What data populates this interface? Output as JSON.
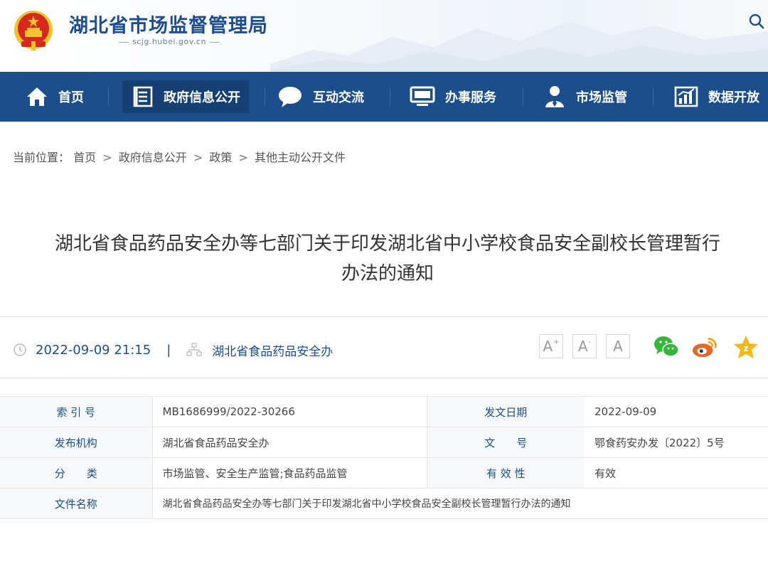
{
  "header": {
    "site_title": "湖北省市场监督管理局",
    "site_domain": "scjg.hubei.gov.cn"
  },
  "nav": {
    "items": [
      {
        "label": "首页",
        "icon": "home-icon"
      },
      {
        "label": "政府信息公开",
        "icon": "document-list-icon",
        "active": true
      },
      {
        "label": "互动交流",
        "icon": "chat-bubble-icon"
      },
      {
        "label": "办事服务",
        "icon": "monitor-icon"
      },
      {
        "label": "市场监管",
        "icon": "inspector-icon"
      },
      {
        "label": "数据开放",
        "icon": "bar-chart-icon"
      }
    ]
  },
  "breadcrumb": {
    "prefix": "当前位置：",
    "items": [
      "首页",
      "政府信息公开",
      "政策",
      "其他主动公开文件"
    ],
    "separator": ">"
  },
  "article": {
    "title_line1": "湖北省食品药品安全办等七部门关于印发湖北省中小学校食品安全副校长管理暂行",
    "title_line2": "办法的通知",
    "date": "2022-09-09 21:15",
    "divider": "|",
    "source": "湖北省食品药品安全办"
  },
  "font_controls": {
    "increase": "A",
    "increase_sup": "+",
    "decrease": "A",
    "decrease_sup": "-",
    "reset": "A"
  },
  "share": [
    "wechat-icon",
    "weibo-icon",
    "favorite-star-icon"
  ],
  "info_table": {
    "rows": [
      {
        "label1": "索 引 号",
        "value1": "MB1686999/2022-30266",
        "label2": "发文日期",
        "value2": "2022-09-09"
      },
      {
        "label1": "发布机构",
        "value1": "湖北省食品药品安全办",
        "label2": "文　　号",
        "value2": "鄂食药安办发〔2022〕5号"
      },
      {
        "label1": "分　　类",
        "value1": "市场监管、安全生产监管;食品药品监管",
        "label2": "有 效 性",
        "value2": "有效"
      }
    ],
    "file_name_label": "文件名称",
    "file_name_value": "湖北省食品药品安全办等七部门关于印发湖北省中小学校食品安全副校长管理暂行办法的通知"
  },
  "colors": {
    "brand_blue": "#1c4e8c",
    "title_blue": "#1d4d91",
    "emblem_red": "#d7281e",
    "emblem_gold": "#f2c230",
    "wechat_green": "#36b53d",
    "weibo_orange": "#e8662a",
    "star_yellow": "#f4b81c"
  }
}
